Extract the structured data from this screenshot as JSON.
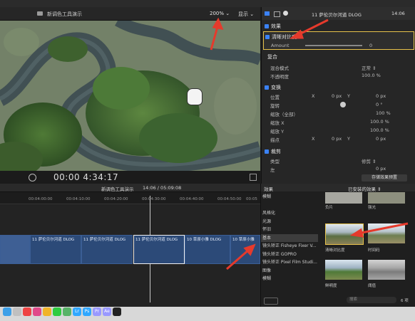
{
  "viewer": {
    "title": "新调色工具演示",
    "zoom": "200%",
    "zoom_caret": "⌄",
    "display_label": "显示",
    "display_caret": "⌄",
    "timecode": "00:00 4:34:17"
  },
  "inspector": {
    "clip_name": "11 萨伦贝尔河道 DLOG",
    "duration": "14:06",
    "effects_label": "效果",
    "effect_name": "清晰对比度",
    "amount_label": "Amount",
    "amount_value": "0",
    "composite_label": "复合",
    "blend_label": "混合模式",
    "blend_value": "正常 ⇕",
    "opacity_label": "不透明度",
    "opacity_value": "100.0 %",
    "transform_label": "变换",
    "pos_label": "位置",
    "pos_x_label": "X",
    "pos_x": "0 px",
    "pos_y_label": "Y",
    "pos_y": "0 px",
    "rot_label": "旋转",
    "rot_value": "0 °",
    "scale_all_label": "缩放（全部）",
    "scale_all": "100 %",
    "scale_x_label": "缩放 X",
    "scale_x": "100.0 %",
    "scale_y_label": "缩放 Y",
    "scale_y": "100.0 %",
    "anchor_label": "描点",
    "anchor_x_label": "X",
    "anchor_x": "0 px",
    "anchor_y_label": "Y",
    "anchor_y": "0 px",
    "crop_label": "裁剪",
    "crop_type_label": "类型",
    "crop_type_value": "修剪 ⇕",
    "left_label": "左",
    "left_value": "0 px",
    "save_preset": "存储效果预置"
  },
  "timeline": {
    "title": "新调色工具演示",
    "duration": "14:06 / 05:09:08",
    "ruler": [
      "00:04:00:00",
      "00:04:10:00",
      "00:04:20:00",
      "00:04:30:00",
      "00:04:40:00",
      "00:04:50:00",
      "00:05"
    ],
    "clips": [
      "11 萨伦贝尔河道 DLOG",
      "11 萨伦贝尔河道 DLOG",
      "11 萨伦贝尔河道 DLOG",
      "10 草原小雅 DLOG",
      "10 草原小雅"
    ]
  },
  "effects_browser": {
    "header": "效果",
    "installed": "已安装的效果 ⇕",
    "categories": [
      "模糊",
      "",
      "风格化",
      "光源",
      "怀旧",
      "基本",
      "镜头矫正 Fisheye Fixer V...",
      "镜头矫正 GOPRO",
      "镜头矫正 Pixel Film Studi...",
      "图像",
      "模糊"
    ],
    "thumbs": [
      {
        "label": "负片"
      },
      {
        "label": "强光"
      },
      {
        "label": "清晰对比度"
      },
      {
        "label": "时间码"
      },
      {
        "label": "鲜明度"
      },
      {
        "label": "阈值"
      }
    ],
    "count": "6 项",
    "search_placeholder": "搜索"
  },
  "colors": {
    "accent": "#3b82f6",
    "arrow": "#e53a2c",
    "clip": "#2c4a78",
    "selection": "#e7c24b"
  },
  "dock": {
    "icons": [
      "finder-icon",
      "launchpad-icon",
      "chrome-icon",
      "itunes-icon",
      "photos-icon",
      "wechat-icon",
      "maps-icon",
      "lightroom-icon",
      "photoshop-icon",
      "premiere-icon",
      "aftereffects-icon",
      "finalcut-icon"
    ]
  }
}
